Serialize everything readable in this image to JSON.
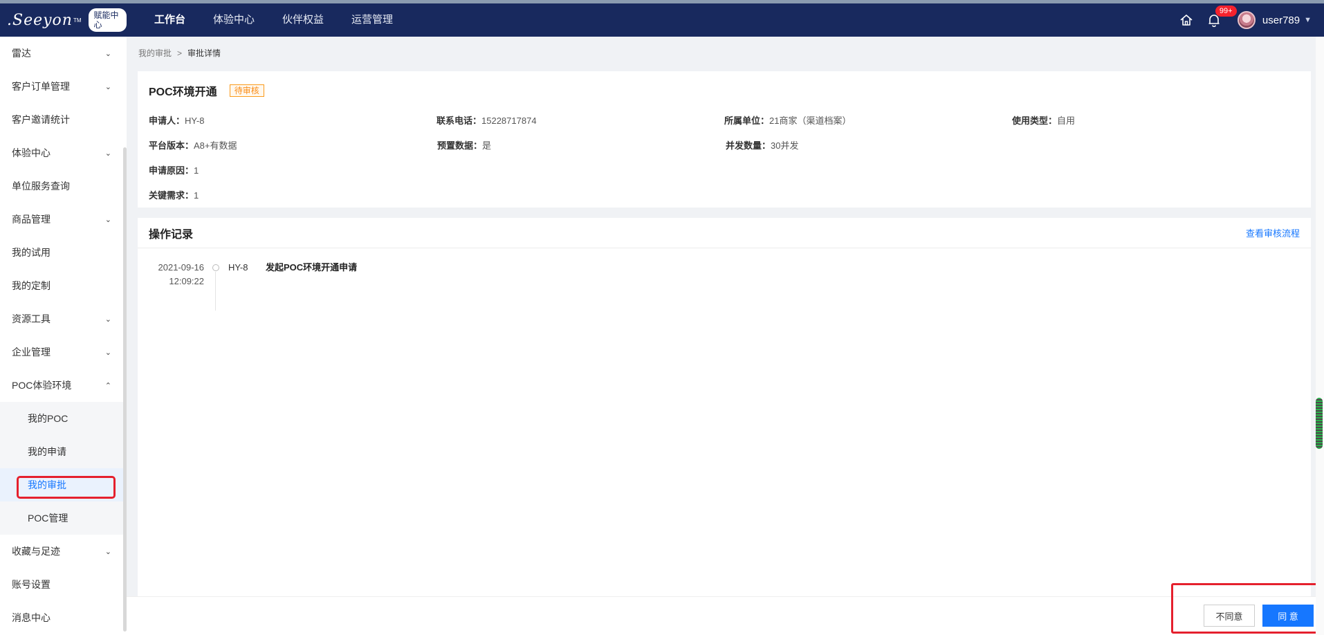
{
  "header": {
    "logo_text": ".Seeyon",
    "logo_tm": "TM",
    "logo_badge": "赋能中心",
    "nav": [
      "工作台",
      "体验中心",
      "伙伴权益",
      "运营管理"
    ],
    "notification_count": "99+",
    "username": "user789"
  },
  "sidebar": {
    "items": [
      {
        "label": "雷达",
        "chevron": "down"
      },
      {
        "label": "客户订单管理",
        "chevron": "down"
      },
      {
        "label": "客户邀请统计"
      },
      {
        "label": "体验中心",
        "chevron": "down"
      },
      {
        "label": "单位服务查询"
      },
      {
        "label": "商品管理",
        "chevron": "down"
      },
      {
        "label": "我的试用"
      },
      {
        "label": "我的定制"
      },
      {
        "label": "资源工具",
        "chevron": "down"
      },
      {
        "label": "企业管理",
        "chevron": "down"
      },
      {
        "label": "POC体验环境",
        "chevron": "up"
      }
    ],
    "sub_items": [
      "我的POC",
      "我的申请",
      "我的审批",
      "POC管理"
    ],
    "active_sub": "我的审批",
    "items_after": [
      {
        "label": "收藏与足迹",
        "chevron": "down"
      },
      {
        "label": "账号设置"
      },
      {
        "label": "消息中心"
      }
    ]
  },
  "breadcrumb": {
    "parent": "我的审批",
    "sep": ">",
    "current": "审批详情"
  },
  "detail": {
    "title": "POC环境开通",
    "status": "待审核",
    "applicant_label": "申请人：",
    "applicant": "HY-8",
    "phone_label": "联系电话：",
    "phone": "15228717874",
    "unit_label": "所属单位：",
    "unit": "21商家（渠道档案）",
    "usage_label": "使用类型：",
    "usage": "自用",
    "version_label": "平台版本：",
    "version": "A8+有数据",
    "preset_label": "预置数据：",
    "preset": "是",
    "concurrency_label": "并发数量：",
    "concurrency": "30并发",
    "reason_label": "申请原因：",
    "reason": "1",
    "key_req_label": "关键需求：",
    "key_req": "1"
  },
  "records": {
    "title": "操作记录",
    "flow_link": "查看审核流程",
    "items": [
      {
        "date": "2021-09-16",
        "time": "12:09:22",
        "user": "HY-8",
        "action": "发起POC环境开通申请"
      }
    ]
  },
  "footer": {
    "reject": "不同意",
    "agree": "同 意"
  },
  "colors": {
    "header_bg": "#18295e",
    "accent": "#1677ff",
    "status": "#fa8c16",
    "highlight": "#e5202d"
  }
}
